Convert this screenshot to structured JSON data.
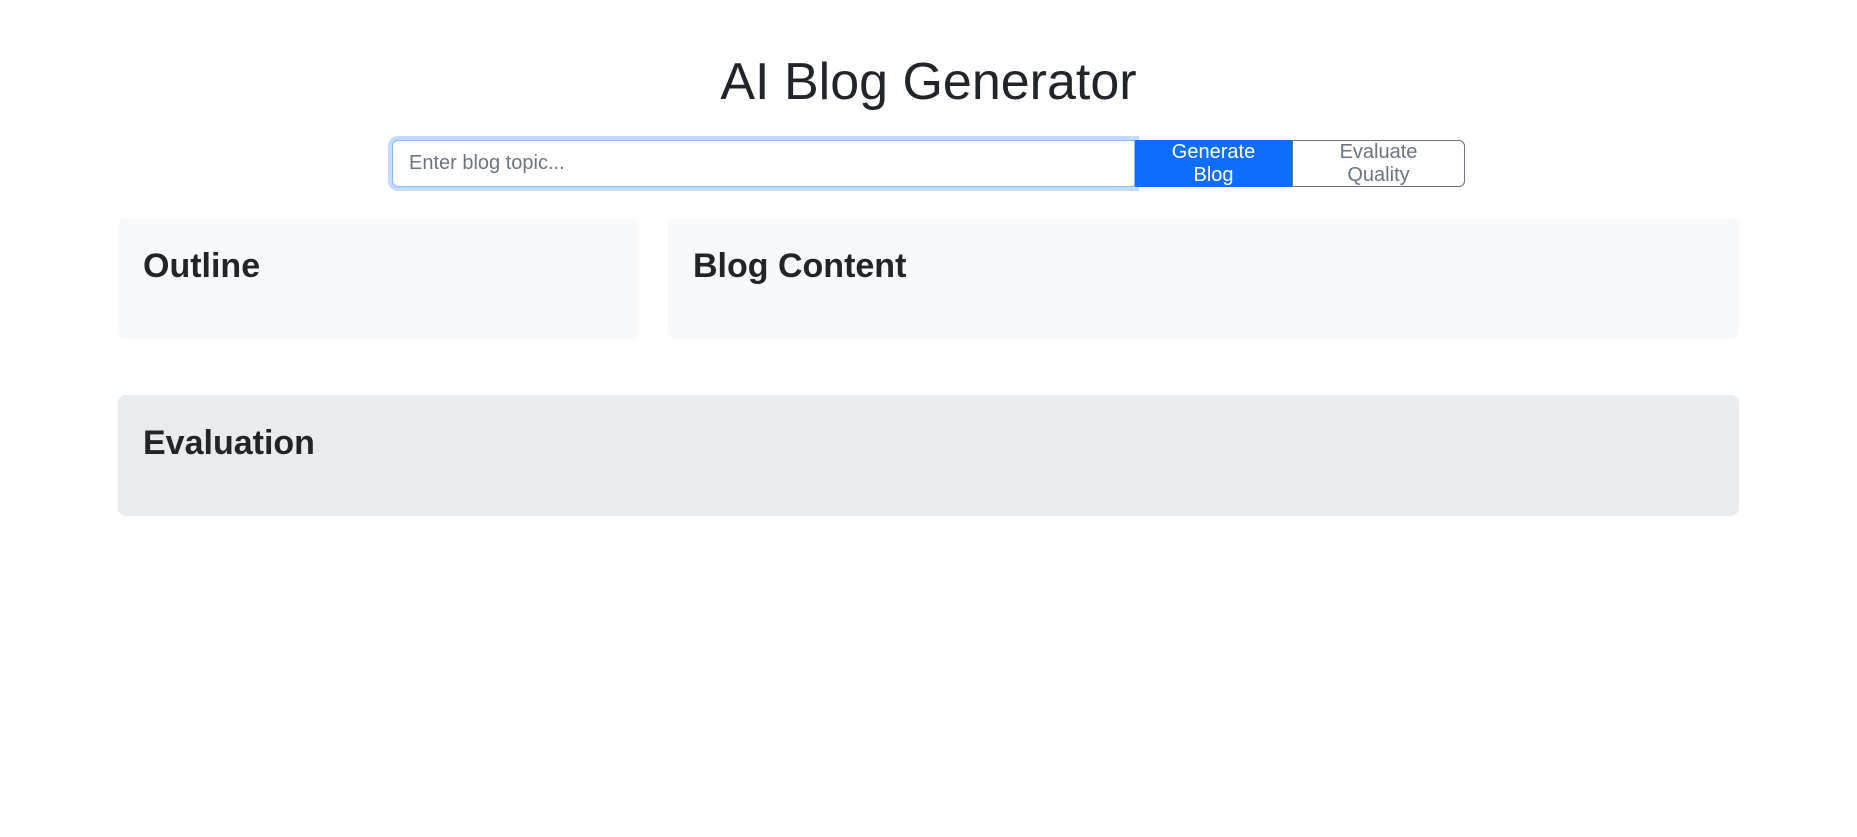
{
  "header": {
    "title": "AI Blog Generator"
  },
  "topic_form": {
    "placeholder": "Enter blog topic...",
    "value": "",
    "generate_label": "Generate Blog",
    "evaluate_label": "Evaluate Quality"
  },
  "panels": {
    "outline_title": "Outline",
    "content_title": "Blog Content",
    "evaluation_title": "Evaluation"
  },
  "colors": {
    "primary": "#0d6efd",
    "secondary": "#6c757d",
    "panel_light": "#f8f9fa",
    "panel_gray": "#e9ecef",
    "text": "#212529"
  }
}
